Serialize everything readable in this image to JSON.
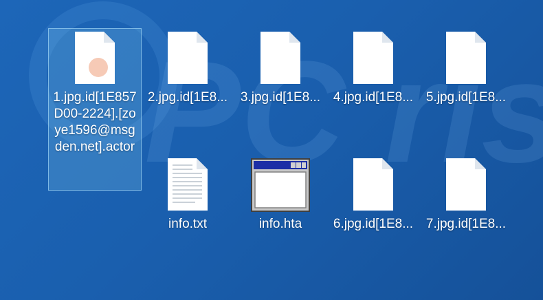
{
  "files": [
    {
      "name": "1.jpg.id[1E857D00-2224].[zoye1596@msgden.net].actor",
      "icon": "encrypted-file-icon",
      "selected": true
    },
    {
      "name": "2.jpg.id[1E8...",
      "icon": "encrypted-file-icon"
    },
    {
      "name": "3.jpg.id[1E8...",
      "icon": "encrypted-file-icon"
    },
    {
      "name": "4.jpg.id[1E8...",
      "icon": "encrypted-file-icon"
    },
    {
      "name": "5.jpg.id[1E8...",
      "icon": "encrypted-file-icon"
    },
    {
      "name": "info.txt",
      "icon": "text-file-icon"
    },
    {
      "name": "info.hta",
      "icon": "hta-application-icon"
    },
    {
      "name": "6.jpg.id[1E8...",
      "icon": "encrypted-file-icon"
    },
    {
      "name": "7.jpg.id[1E8...",
      "icon": "encrypted-file-icon"
    }
  ],
  "watermark": {
    "text": "PC risk.com"
  },
  "colors": {
    "background": "#1a5fae",
    "selection": "#78bee6",
    "label": "#ffffff"
  }
}
